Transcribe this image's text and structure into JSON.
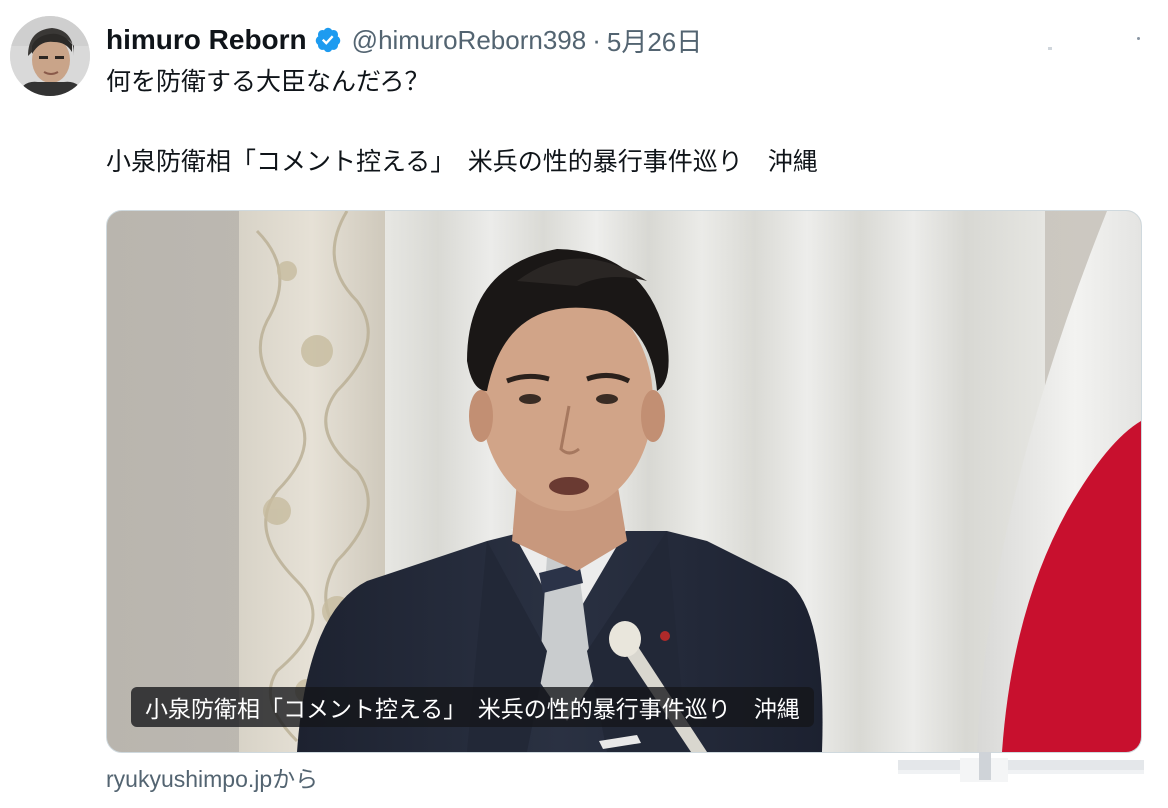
{
  "author": {
    "display_name": "himuro Reborn",
    "verified": true,
    "handle": "@himuroReborn398",
    "separator": "·",
    "date": "5月26日"
  },
  "tweet": {
    "line1": "何を防衛する大臣なんだろ？",
    "line2": "小泉防衛相「コメント控える」　米兵の性的暴行事件巡り　沖縄"
  },
  "card": {
    "caption": "小泉防衛相「コメント控える」　米兵の性的暴行事件巡り　沖縄",
    "source": "ryukyushimpo.jpから"
  },
  "icons": {
    "avatar": "avatar",
    "verified": "verified-badge-icon",
    "more": "more-icon"
  },
  "colors": {
    "verified_blue": "#1d9bf0",
    "text_primary": "#0f1419",
    "text_secondary": "#536471",
    "flag_red": "#c8102e"
  }
}
